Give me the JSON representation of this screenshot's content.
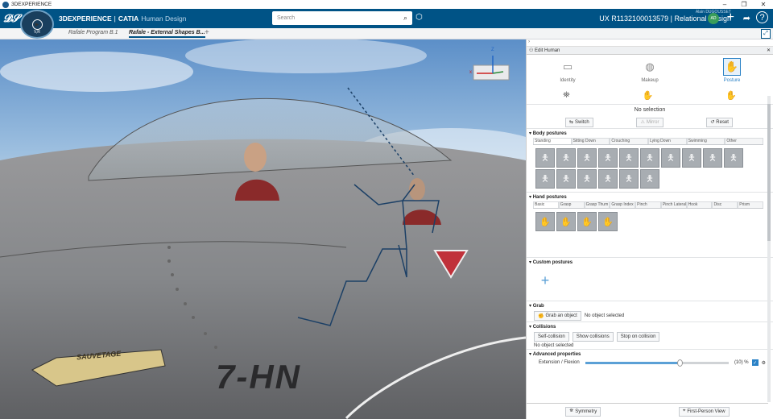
{
  "window": {
    "title": "3DEXPERIENCE",
    "controls": [
      "–",
      "❐",
      "✕"
    ]
  },
  "topbar": {
    "brand_bold": "3DEXPERIENCE",
    "brand_sep": "|",
    "brand_app": "CATIA",
    "brand_sub": "Human Design",
    "compass_label": "V,R",
    "search_placeholder": "Search",
    "user_name": "Alain DUGOUSSET",
    "context": "UX R1132100013579 | Relational Design",
    "avatar_initials": "AD"
  },
  "tabs": {
    "tab1": "Rafale Program B.1",
    "tab2": "Rafale - External Shapes B...",
    "add": "+"
  },
  "viewport": {
    "aircraft_code": "7-HN",
    "placard": "SAUVETAGE",
    "axis_z": "Z",
    "axis_x": "x"
  },
  "panel": {
    "title": "Edit Human",
    "modes": [
      {
        "label": "Identity"
      },
      {
        "label": "Makeup"
      },
      {
        "label": "Posture"
      }
    ],
    "selection": "No selection",
    "actions": {
      "switch": "Switch",
      "mirror": "Mirror",
      "reset": "Reset"
    },
    "body_postures": {
      "title": "Body postures",
      "tabs": [
        "Standing",
        "Sitting Down",
        "Crouching",
        "Lying Down",
        "Swimming",
        "Other"
      ]
    },
    "hand_postures": {
      "title": "Hand postures",
      "tabs": [
        "Basic",
        "Grasp",
        "Grasp Thum",
        "Grasp Index",
        "Pinch",
        "Pinch Lateral",
        "Hook",
        "Disc",
        "Prism"
      ]
    },
    "custom_postures": {
      "title": "Custom postures"
    },
    "grab": {
      "title": "Grab",
      "button": "Grab an object",
      "status": "No object selected"
    },
    "collisions": {
      "title": "Collisions",
      "buttons": [
        "Self-collision",
        "Show collisions",
        "Stop on collision"
      ],
      "status": "No object selected"
    },
    "advanced": {
      "title": "Advanced properties",
      "slider_label": "Extension / Flexion",
      "value": "(10) %",
      "fraction": 0.66
    },
    "footer": {
      "symmetry": "Symmetry",
      "first_person": "First-Person View"
    }
  }
}
